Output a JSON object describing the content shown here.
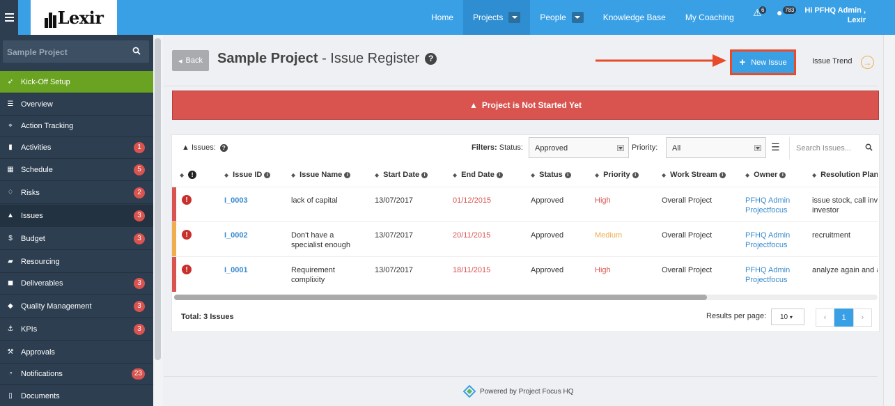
{
  "topbar": {
    "logo": "Lexir",
    "nav": [
      "Home",
      "Projects",
      "People",
      "Knowledge Base",
      "My Coaching"
    ],
    "alerts_count": "6",
    "messages_count": "783",
    "user_line1": "Hi PFHQ Admin ,",
    "user_line2": "Lexir"
  },
  "sidebar": {
    "search_value": "Sample Project",
    "items": [
      {
        "label": "Kick-Off Setup",
        "badge": ""
      },
      {
        "label": "Overview",
        "badge": ""
      },
      {
        "label": "Action Tracking",
        "badge": ""
      },
      {
        "label": "Activities",
        "badge": "1"
      },
      {
        "label": "Schedule",
        "badge": "5"
      },
      {
        "label": "Risks",
        "badge": "2"
      },
      {
        "label": "Issues",
        "badge": "3"
      },
      {
        "label": "Budget",
        "badge": "3"
      },
      {
        "label": "Resourcing",
        "badge": ""
      },
      {
        "label": "Deliverables",
        "badge": "3"
      },
      {
        "label": "Quality Management",
        "badge": "3"
      },
      {
        "label": "KPIs",
        "badge": "3"
      },
      {
        "label": "Approvals",
        "badge": ""
      },
      {
        "label": "Notifications",
        "badge": "23"
      },
      {
        "label": "Documents",
        "badge": ""
      }
    ]
  },
  "header": {
    "back": "Back",
    "project": "Sample Project",
    "separator": " - ",
    "section": "Issue Register",
    "help": "?",
    "new_issue": "New Issue",
    "issue_trend": "Issue Trend"
  },
  "alert": "Project is Not Started Yet",
  "toolbar": {
    "issues_label": "Issues:",
    "filters_label": "Filters:",
    "status_label": "Status:",
    "status_value": "Approved",
    "priority_label": "Priority:",
    "priority_value": "All",
    "search_placeholder": "Search Issues..."
  },
  "table": {
    "columns": [
      "Issue ID",
      "Issue Name",
      "Start Date",
      "End Date",
      "Status",
      "Priority",
      "Work Stream",
      "Owner",
      "Resolution Plans"
    ],
    "rows": [
      {
        "id": "I_0003",
        "name1": "lack of capital",
        "name2": "",
        "start": "13/07/2017",
        "end": "01/12/2015",
        "status": "Approved",
        "priority": "High",
        "stream": "Overall Project",
        "owner1": "PFHQ Admin",
        "owner2": "Projectfocus",
        "plan1": "issue stock, call inve",
        "plan2": "investor",
        "bar": "#d9534f",
        "pcls": "red"
      },
      {
        "id": "I_0002",
        "name1": "Don't have a",
        "name2": "specialist enough",
        "start": "13/07/2017",
        "end": "20/11/2015",
        "status": "Approved",
        "priority": "Medium",
        "stream": "Overall Project",
        "owner1": "PFHQ Admin",
        "owner2": "Projectfocus",
        "plan1": "recruitment",
        "plan2": "",
        "bar": "#f0ad4e",
        "pcls": "orange"
      },
      {
        "id": "I_0001",
        "name1": "Requirement",
        "name2": "complixity",
        "start": "13/07/2017",
        "end": "18/11/2015",
        "status": "Approved",
        "priority": "High",
        "stream": "Overall Project",
        "owner1": "PFHQ Admin",
        "owner2": "Projectfocus",
        "plan1": "analyze again and a",
        "plan2": "",
        "bar": "#d9534f",
        "pcls": "red"
      }
    ]
  },
  "footer_bar": {
    "total": "Total: 3 Issues",
    "results_per_page": "Results per page:",
    "per_page_value": "10",
    "page": "1"
  },
  "footer": "Powered by Project Focus HQ"
}
